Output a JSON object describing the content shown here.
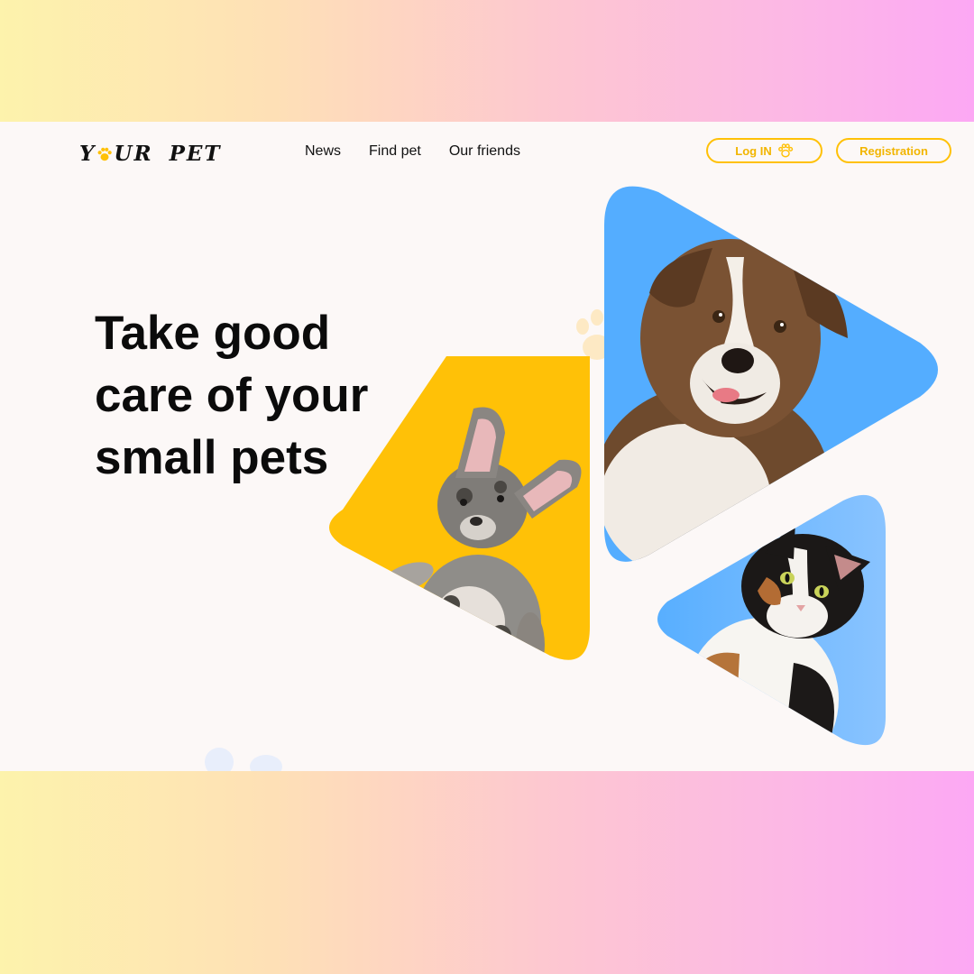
{
  "header": {
    "logo": {
      "text_before": "Y",
      "text_after": "UR",
      "text_second": "PET"
    },
    "nav": [
      {
        "label": "News"
      },
      {
        "label": "Find pet"
      },
      {
        "label": "Our friends"
      }
    ],
    "login_label": "Log IN",
    "register_label": "Registration"
  },
  "hero": {
    "headline": [
      "Take good",
      "care of your",
      "small pets"
    ]
  },
  "colors": {
    "accent": "#ffc107",
    "shape_blue": "#54adff",
    "shape_yellow": "#ffc107",
    "page_bg": "#fcf8f7"
  },
  "icons": {
    "logo_paw": "paw-icon",
    "login_paw": "paw-icon"
  }
}
